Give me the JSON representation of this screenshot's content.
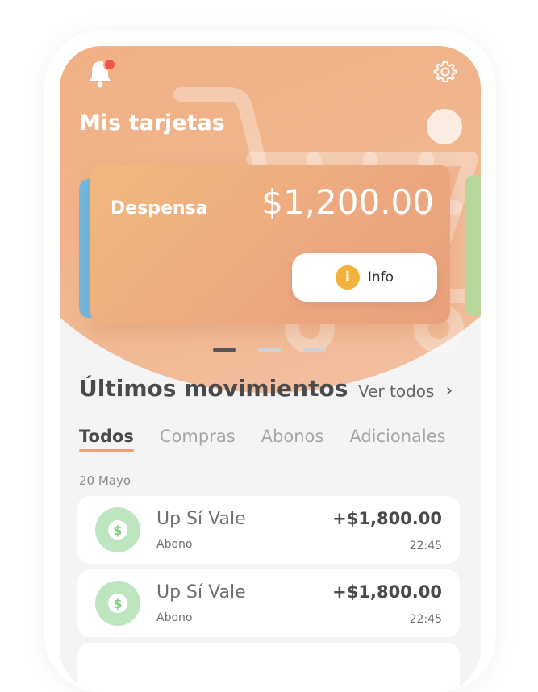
{
  "header": {
    "title": "Mis tarjetas",
    "notification_badge": true
  },
  "card": {
    "name": "Despensa",
    "amount": "$1,200.00",
    "info_label": "Info",
    "info_icon_glyph": "i"
  },
  "carousel": {
    "pages": 3,
    "active": 0
  },
  "movements": {
    "title": "Últimos movimientos",
    "see_all": "Ver todos",
    "tabs": [
      "Todos",
      "Compras",
      "Abonos",
      "Adicionales"
    ],
    "active_tab": "Todos",
    "date": "20 Mayo",
    "items": [
      {
        "name": "Up Sí Vale",
        "type": "Abono",
        "amount": "+$1,800.00",
        "time": "22:45",
        "icon_glyph": "$"
      },
      {
        "name": "Up Sí Vale",
        "type": "Abono",
        "amount": "+$1,800.00",
        "time": "22:45",
        "icon_glyph": "$"
      }
    ]
  },
  "colors": {
    "accent": "#f2ab7a",
    "card": "#eda880",
    "badge": "#f0544f",
    "info": "#f2b23c",
    "income_icon": "#bde6c0"
  },
  "icons": {
    "bell": "bell-icon",
    "settings": "gear-icon",
    "info": "info-icon",
    "chevron": "chevron-right-icon",
    "transaction": "dollar-icon",
    "background": "shopping-cart-icon"
  }
}
